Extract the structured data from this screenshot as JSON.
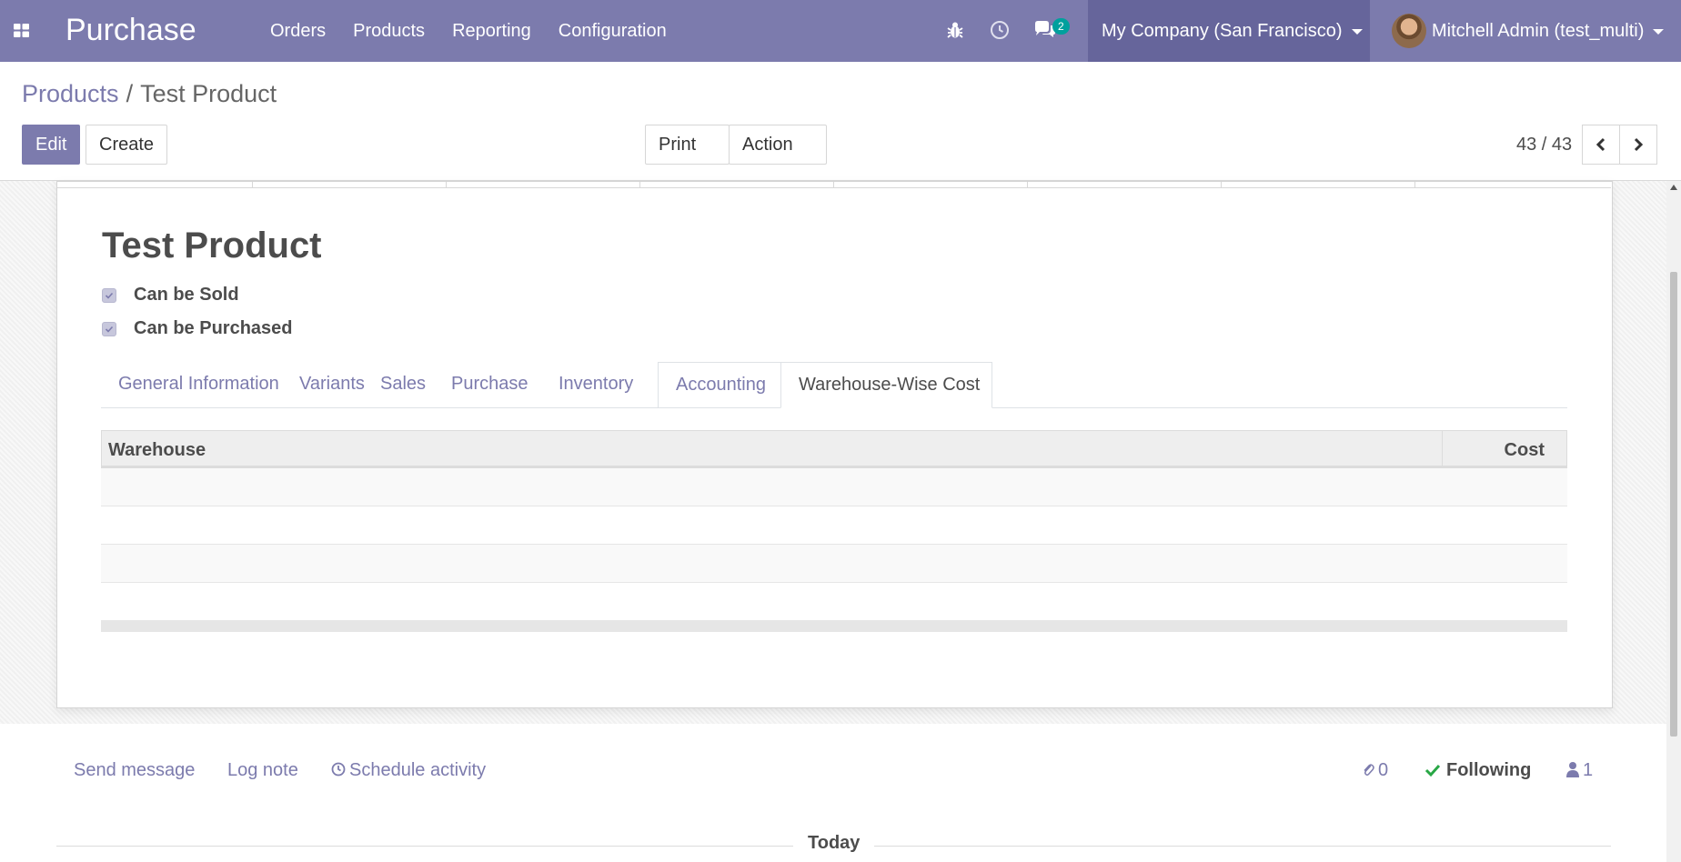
{
  "navbar": {
    "app_name": "Purchase",
    "menu": [
      "Orders",
      "Products",
      "Reporting",
      "Configuration"
    ],
    "icons": [
      "apps-grid-icon",
      "bug-icon",
      "clock-icon",
      "chat-icon"
    ],
    "messages_badge": "2",
    "company": "My Company (San Francisco)",
    "user": "Mitchell Admin (test_multi)",
    "color": "#7c7bad"
  },
  "breadcrumb": {
    "parent": "Products",
    "separator": "/",
    "current": "Test Product"
  },
  "toolbar": {
    "edit_label": "Edit",
    "create_label": "Create",
    "print_label": "Print",
    "action_label": "Action"
  },
  "pager": {
    "value": "43 / 43"
  },
  "product": {
    "name": "Test Product",
    "can_be_sold_label": "Can be Sold",
    "can_be_sold": true,
    "can_be_purchased_label": "Can be Purchased",
    "can_be_purchased": true
  },
  "tabs": [
    {
      "label": "General Information"
    },
    {
      "label": "Variants"
    },
    {
      "label": "Sales"
    },
    {
      "label": "Purchase"
    },
    {
      "label": "Inventory"
    },
    {
      "label": "Accounting"
    },
    {
      "label": "Warehouse-Wise Cost",
      "active": true
    }
  ],
  "table": {
    "columns": [
      "Warehouse",
      "Cost"
    ],
    "rows": []
  },
  "chatter": {
    "send_message": "Send message",
    "log_note": "Log note",
    "schedule_activity": "Schedule activity",
    "attachments_count": "0",
    "following_label": "Following",
    "followers_count": "1",
    "date_separator": "Today"
  }
}
